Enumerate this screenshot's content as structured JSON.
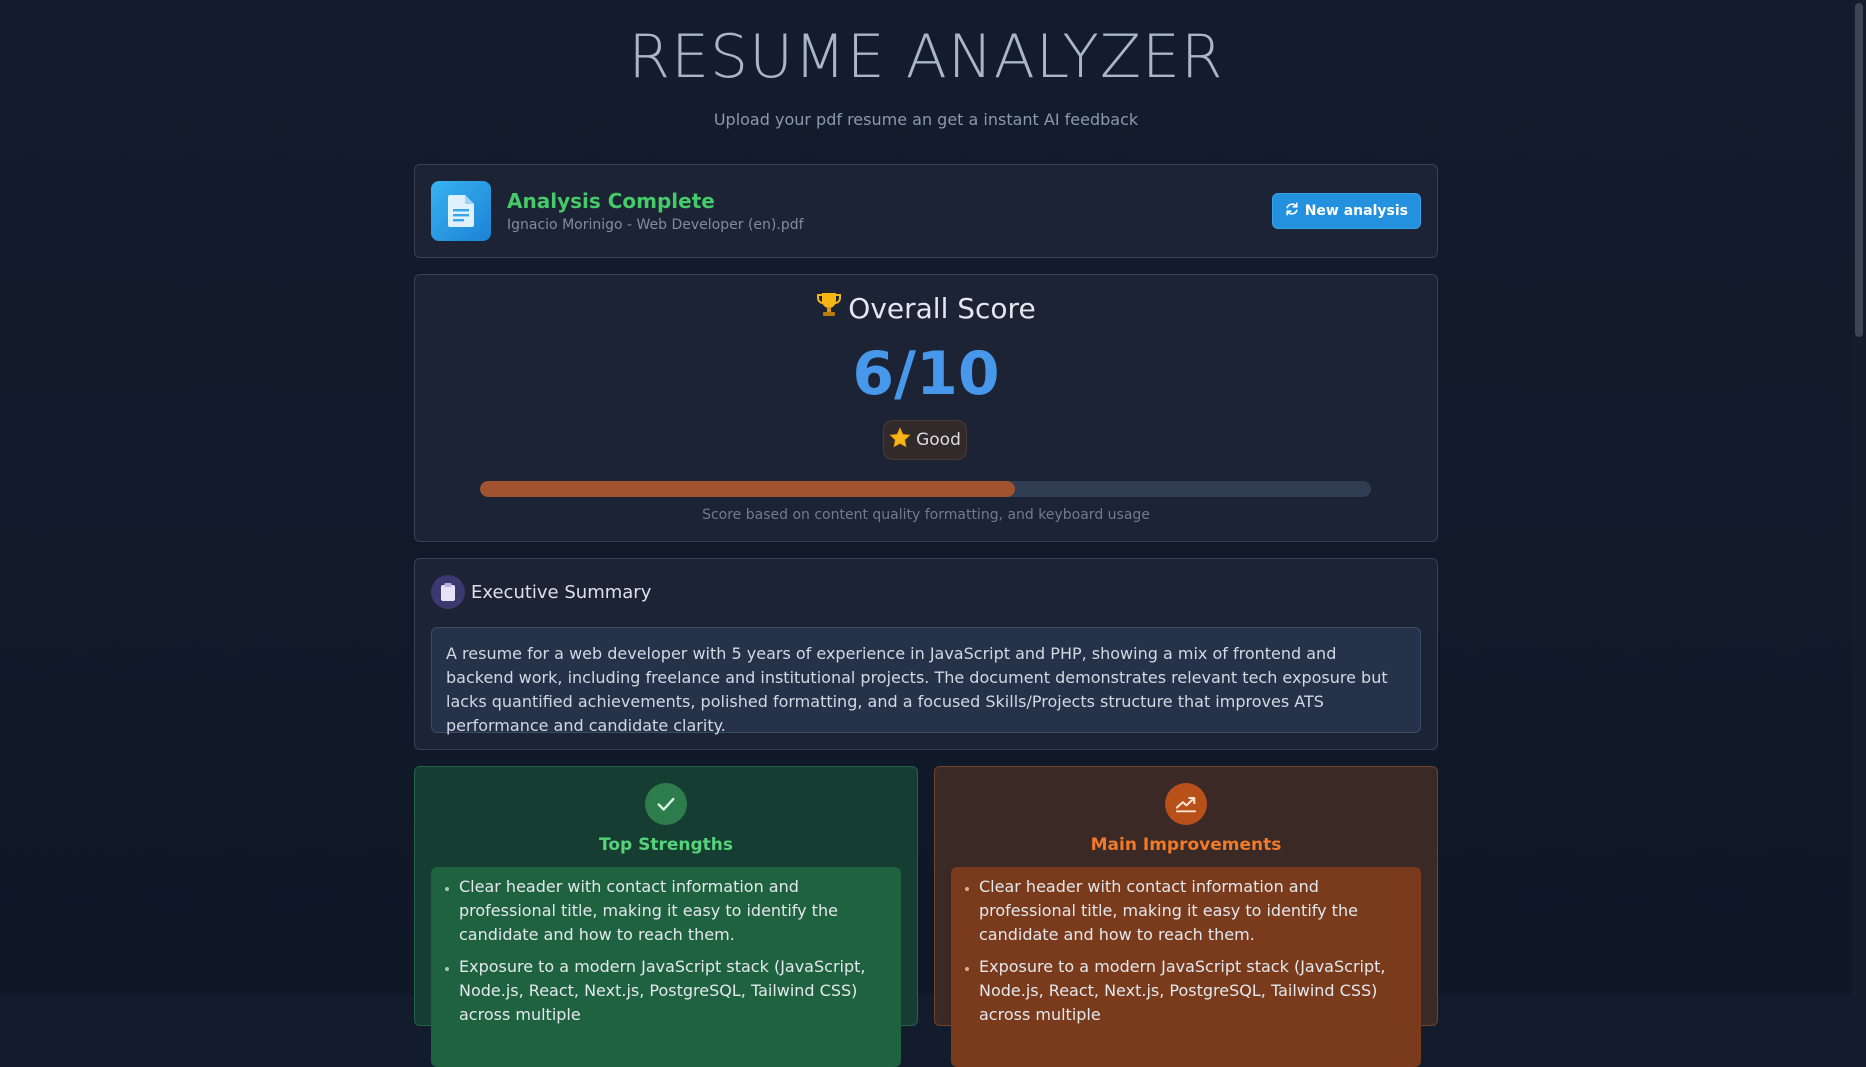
{
  "header": {
    "title": "RESUME ANALYZER",
    "subtitle": "Upload your pdf resume an get a instant AI feedback"
  },
  "status": {
    "title": "Analysis Complete",
    "file_name": "Ignacio Morinigo - Web Developer (en).pdf",
    "new_button": "New analysis",
    "icon": "file-text-icon"
  },
  "score": {
    "title": "Overall Score",
    "value": "6/10",
    "fraction": 0.6,
    "badge": "Good",
    "caption": "Score based on content quality formatting, and keyboard usage",
    "bar_color": "#a0532e",
    "value_color": "#4797ea"
  },
  "summary": {
    "title": "Executive Summary",
    "text": "A resume for a web developer with 5 years of experience in JavaScript and PHP, showing a mix of frontend and backend work, including freelance and institutional projects. The document demonstrates relevant tech exposure but lacks quantified achievements, polished formatting, and a focused Skills/Projects structure that improves ATS performance and candidate clarity."
  },
  "strengths": {
    "title": "Top Strengths",
    "items": [
      "Clear header with contact information and professional title, making it easy to identify the candidate and how to reach them.",
      "Exposure to a modern JavaScript stack (JavaScript, Node.js, React, Next.js, PostgreSQL, Tailwind CSS) across multiple"
    ]
  },
  "improvements": {
    "title": "Main Improvements",
    "items": [
      "Clear header with contact information and professional title, making it easy to identify the candidate and how to reach them.",
      "Exposure to a modern JavaScript stack (JavaScript, Node.js, React, Next.js, PostgreSQL, Tailwind CSS) across multiple"
    ]
  }
}
